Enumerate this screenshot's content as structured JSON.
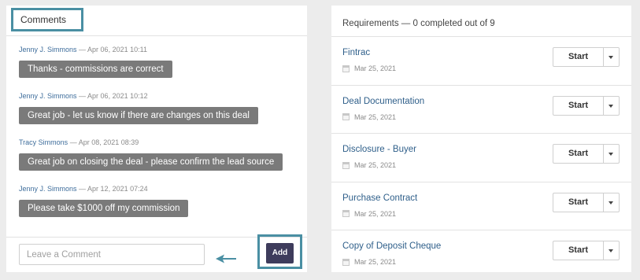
{
  "comments": {
    "header_label": "Comments",
    "items": [
      {
        "author": "Jenny J. Simmons",
        "timestamp": "— Apr 06, 2021 10:11",
        "text": "Thanks - commissions are correct"
      },
      {
        "author": "Jenny J. Simmons",
        "timestamp": "— Apr 06, 2021 10:12",
        "text": "Great job - let us know if there are changes on this deal"
      },
      {
        "author": "Tracy Simmons",
        "timestamp": "— Apr 08, 2021 08:39",
        "text": "Great job on closing the deal - please confirm the lead source"
      },
      {
        "author": "Jenny J. Simmons",
        "timestamp": "— Apr 12, 2021 07:24",
        "text": "Please take $1000 off my commission"
      }
    ],
    "input_placeholder": "Leave a Comment",
    "input_value": "",
    "add_label": "Add"
  },
  "requirements": {
    "header": "Requirements — 0 completed out of 9",
    "items": [
      {
        "title": "Fintrac",
        "date": "Mar 25, 2021",
        "button": "Start"
      },
      {
        "title": "Deal Documentation",
        "date": "Mar 25, 2021",
        "button": "Start"
      },
      {
        "title": "Disclosure - Buyer",
        "date": "Mar 25, 2021",
        "button": "Start"
      },
      {
        "title": "Purchase Contract",
        "date": "Mar 25, 2021",
        "button": "Start"
      },
      {
        "title": "Copy of Deposit Cheque",
        "date": "Mar 25, 2021",
        "button": "Start"
      }
    ]
  },
  "colors": {
    "highlight": "#4a8fa3",
    "add_button": "#3e3c5c",
    "comment_bubble": "#7a7a7a",
    "link": "#2f5f8a"
  },
  "icons": {
    "calendar": "calendar-icon",
    "dropdown": "chevron-down-icon",
    "annotation": "arrow-left-icon"
  }
}
